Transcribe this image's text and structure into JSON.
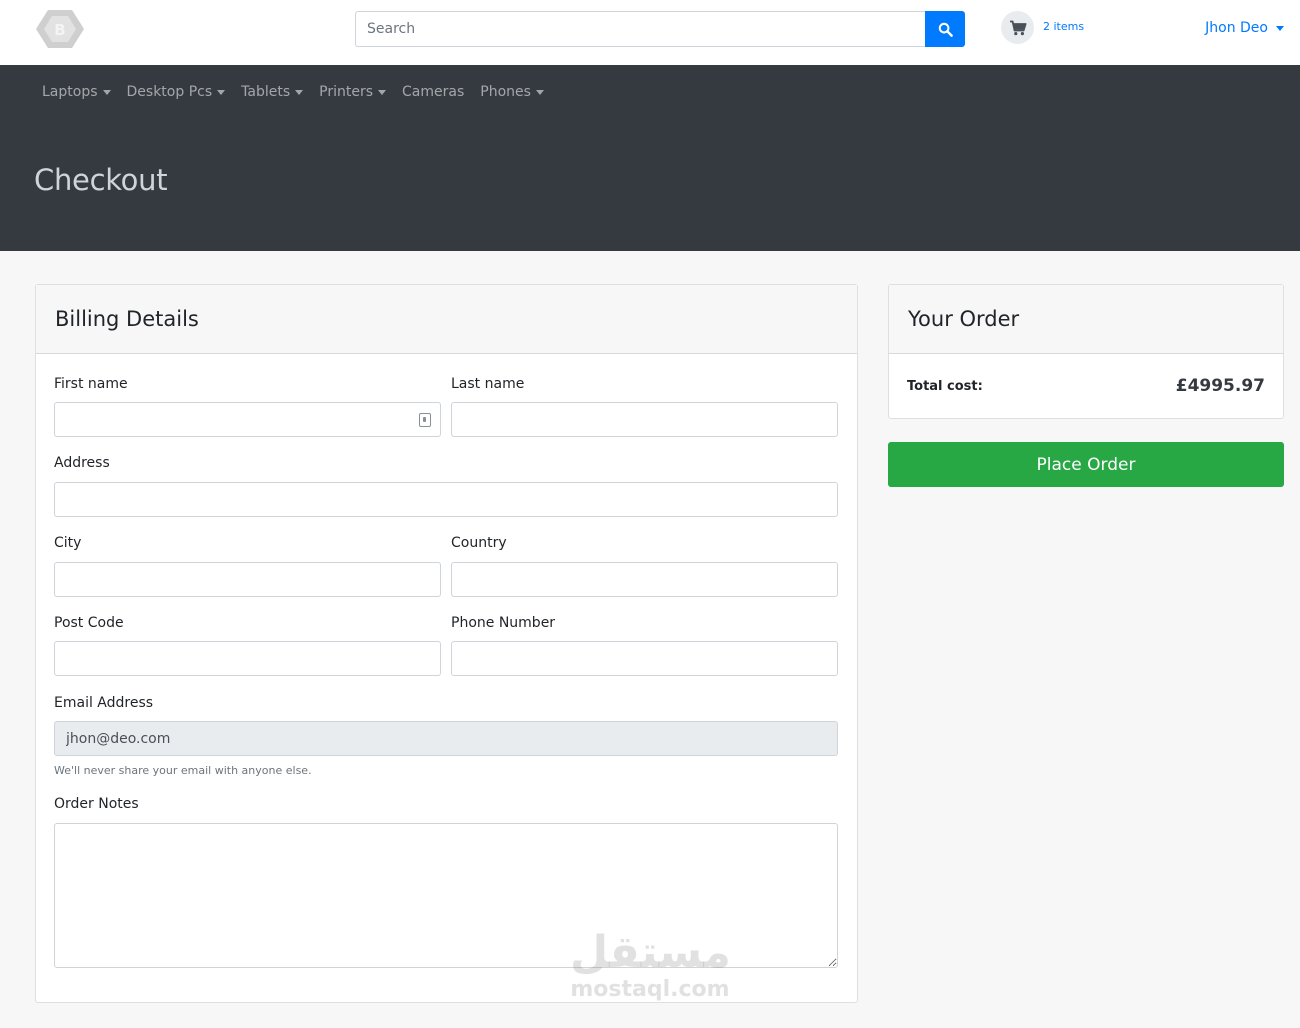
{
  "header": {
    "search_placeholder": "Search",
    "cart_count": "2 items",
    "user_name": "Jhon Deo",
    "brand_color": "#007bff"
  },
  "nav": {
    "items": [
      {
        "label": "Laptops",
        "dropdown": true
      },
      {
        "label": "Desktop Pcs",
        "dropdown": true
      },
      {
        "label": "Tablets",
        "dropdown": true
      },
      {
        "label": "Printers",
        "dropdown": true
      },
      {
        "label": "Cameras",
        "dropdown": false
      },
      {
        "label": "Phones",
        "dropdown": true
      }
    ]
  },
  "page": {
    "title": "Checkout"
  },
  "billing": {
    "title": "Billing Details",
    "fields": {
      "first_name": {
        "label": "First name",
        "value": ""
      },
      "last_name": {
        "label": "Last name",
        "value": ""
      },
      "address": {
        "label": "Address",
        "value": ""
      },
      "city": {
        "label": "City",
        "value": ""
      },
      "country": {
        "label": "Country",
        "value": ""
      },
      "post_code": {
        "label": "Post Code",
        "value": ""
      },
      "phone": {
        "label": "Phone Number",
        "value": ""
      },
      "email": {
        "label": "Email Address",
        "value": "jhon@deo.com",
        "help": "We'll never share your email with anyone else."
      },
      "notes": {
        "label": "Order Notes",
        "value": ""
      }
    }
  },
  "order": {
    "title": "Your Order",
    "total_label": "Total cost:",
    "total_value": "£4995.97",
    "place_order_label": "Place Order",
    "button_color": "#28a745"
  },
  "watermark": {
    "arabic": "مستقل",
    "latin": "mostaql.com"
  }
}
